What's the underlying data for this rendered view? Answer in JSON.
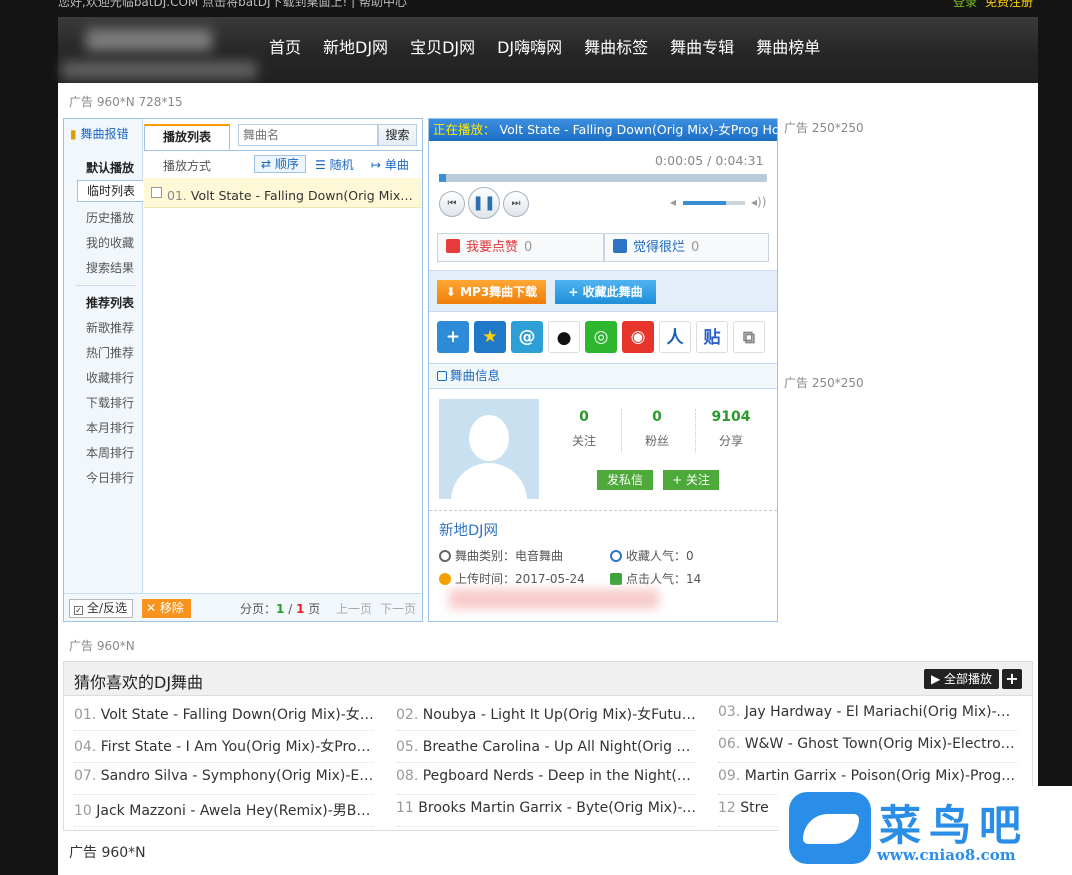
{
  "topbar": {
    "welcome": "您好,欢迎光临batDJ.COM 点击将batDJ下载到桌面上! | 帮助中心",
    "login": "登录",
    "register": "免费注册"
  },
  "nav": [
    "首页",
    "新地DJ网",
    "宝贝DJ网",
    "DJ嗨嗨网",
    "舞曲标签",
    "舞曲专辑",
    "舞曲榜单"
  ],
  "ads": {
    "top": "广告 960*N 728*15",
    "right1": "广告 250*250",
    "right2": "广告 250*250",
    "mid": "广告 960*N",
    "bottom": "广告 960*N"
  },
  "playlist": {
    "report": "舞曲报错",
    "default_group": "默认播放",
    "default_items": [
      "临时列表",
      "历史播放",
      "我的收藏",
      "搜索结果"
    ],
    "recommend_group": "推荐列表",
    "recommend_items": [
      "新歌推荐",
      "热门推荐",
      "收藏排行",
      "下载排行",
      "本月排行",
      "本周排行",
      "今日排行"
    ],
    "tab": "播放列表",
    "search_placeholder": "舞曲名",
    "search_button": "搜索",
    "mode_label": "播放方式",
    "modes": [
      "顺序",
      "随机",
      "单曲"
    ],
    "tracks": [
      {
        "num": "01.",
        "title": "Volt State - Falling Down(Orig Mix)-女Prog House"
      }
    ],
    "select_all": "全/反选",
    "remove": "移除",
    "page_label": "分页：",
    "page_current": "1",
    "page_sep": "/",
    "page_total": "1",
    "page_unit": "页",
    "prev": "上一页",
    "next": "下一页"
  },
  "player": {
    "now_playing_label": "正在播放：",
    "now_playing": "Volt State - Falling Down(Orig Mix)-女Prog House",
    "time": "0:00:05 / 0:04:31",
    "progress": 0.02,
    "volume": 0.7,
    "like_label": "我要点赞",
    "like_count": "0",
    "dislike_label": "觉得很烂",
    "dislike_count": "0",
    "download_button": "MP3舞曲下载",
    "favorite_button": "收藏此舞曲",
    "share_icons": [
      "add-share-icon",
      "qzone-icon",
      "qq-weibo-icon",
      "qq-icon",
      "wechat-icon",
      "sina-weibo-icon",
      "renren-icon",
      "tieba-icon",
      "copy-link-icon"
    ],
    "info_title": "舞曲信息",
    "stats": [
      {
        "value": "0",
        "label": "关注"
      },
      {
        "value": "0",
        "label": "粉丝"
      },
      {
        "value": "9104",
        "label": "分享"
      }
    ],
    "message_button": "发私信",
    "follow_button": "+ 关注",
    "uploader": "新地DJ网",
    "category": "舞曲类别：电音舞曲",
    "favorites": "收藏人气：0",
    "upload_time": "上传时间：2017-05-24",
    "clicks": "点击人气：14"
  },
  "recommend": {
    "title": "猜你喜欢的DJ舞曲",
    "play_all": "全部播放",
    "items": [
      {
        "num": "01.",
        "title": "Volt State - Falling Down(Orig Mix)-女Prog House"
      },
      {
        "num": "02.",
        "title": "Noubya - Light It Up(Orig Mix)-女Future House"
      },
      {
        "num": "03.",
        "title": "Jay Hardway - El Mariachi(Orig Mix)-Big Room"
      },
      {
        "num": "04.",
        "title": "First State - I Am You(Orig Mix)-女Prog House"
      },
      {
        "num": "05.",
        "title": "Breathe Carolina - Up All Night(Orig Mix)-女Electro"
      },
      {
        "num": "06.",
        "title": "W&W - Ghost Town(Orig Mix)-Electro House"
      },
      {
        "num": "07.",
        "title": "Sandro Silva - Symphony(Orig Mix)-Electro House"
      },
      {
        "num": "08.",
        "title": "Pegboard Nerds - Deep in the Night(Orig Mix)"
      },
      {
        "num": "09.",
        "title": "Martin Garrix - Poison(Orig Mix)-Prog House"
      },
      {
        "num": "10",
        "title": "Jack Mazzoni - Awela Hey(Remix)-男Big Room"
      },
      {
        "num": "11",
        "title": "Brooks Martin Garrix - Byte(Orig Mix)-Big Room"
      },
      {
        "num": "12",
        "title": "Stre"
      }
    ]
  },
  "watermark": {
    "name": "菜鸟吧",
    "url": "www.cniao8.com"
  }
}
